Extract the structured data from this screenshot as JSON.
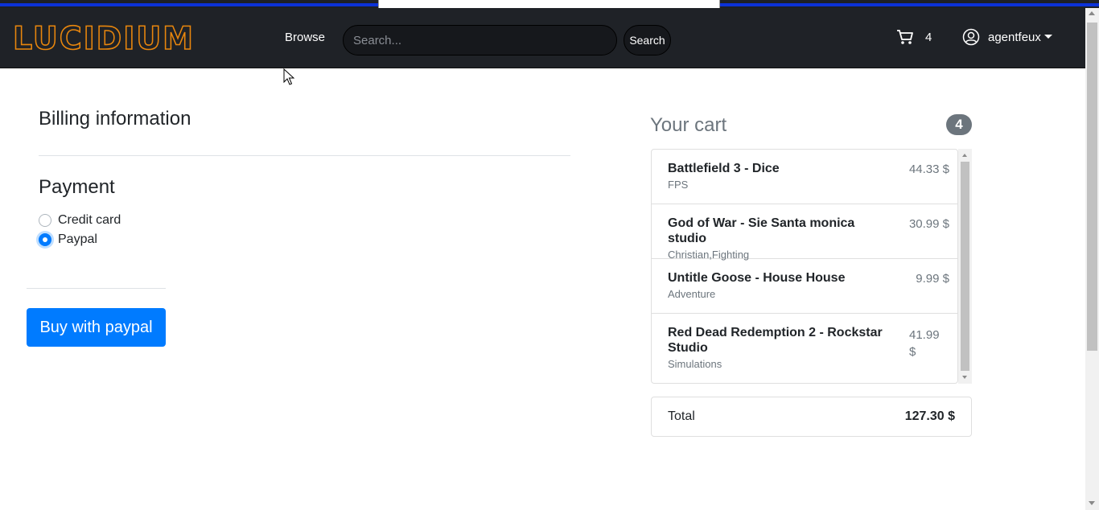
{
  "brand": {
    "name": "LUCIDIUM",
    "color": "#e8860d"
  },
  "nav": {
    "browse": "Browse",
    "search_placeholder": "Search...",
    "search_button": "Search",
    "cart_count": "4",
    "username": "agentfeux"
  },
  "billing": {
    "title": "Billing information",
    "payment_title": "Payment",
    "options": [
      {
        "label": "Credit card",
        "checked": false
      },
      {
        "label": "Paypal",
        "checked": true
      }
    ],
    "buy_button": "Buy with paypal"
  },
  "cart": {
    "title": "Your cart",
    "badge": "4",
    "items": [
      {
        "name": "Battlefield 3 - Dice",
        "category": "FPS",
        "price": "44.33 $"
      },
      {
        "name": "God of War - Sie Santa monica studio",
        "category": "Christian,Fighting",
        "price": "30.99 $"
      },
      {
        "name": "Untitle Goose - House House",
        "category": "Adventure",
        "price": "9.99 $"
      },
      {
        "name": "Red Dead Redemption 2 - Rockstar Studio",
        "category": "Simulations",
        "price": "41.99 $"
      }
    ],
    "total_label": "Total",
    "total_value": "127.30 $"
  },
  "colors": {
    "navbar": "#1f2227",
    "primary": "#007bff",
    "badge": "#6c757d"
  }
}
